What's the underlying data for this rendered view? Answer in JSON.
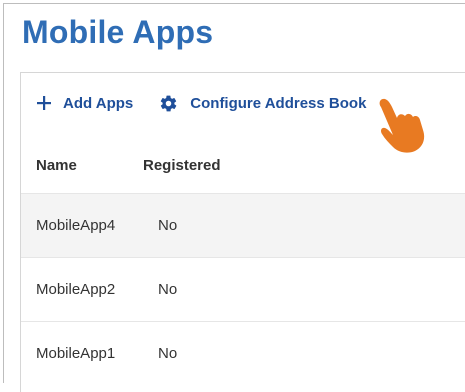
{
  "page": {
    "title": "Mobile Apps"
  },
  "toolbar": {
    "add_label": "Add Apps",
    "configure_label": "Configure Address Book"
  },
  "table": {
    "headers": {
      "name": "Name",
      "registered": "Registered"
    },
    "rows": [
      {
        "name": "MobileApp4",
        "registered": "No"
      },
      {
        "name": "MobileApp2",
        "registered": "No"
      },
      {
        "name": "MobileApp1",
        "registered": "No"
      }
    ]
  },
  "colors": {
    "title": "#2f6db5",
    "toolbar_text": "#1f4f9a",
    "cursor_hand": "#e87a22",
    "row_highlight": "#f4f4f4"
  },
  "icons": {
    "add": "plus-icon",
    "configure": "gear-icon",
    "pointer": "pointing-hand-cursor"
  }
}
